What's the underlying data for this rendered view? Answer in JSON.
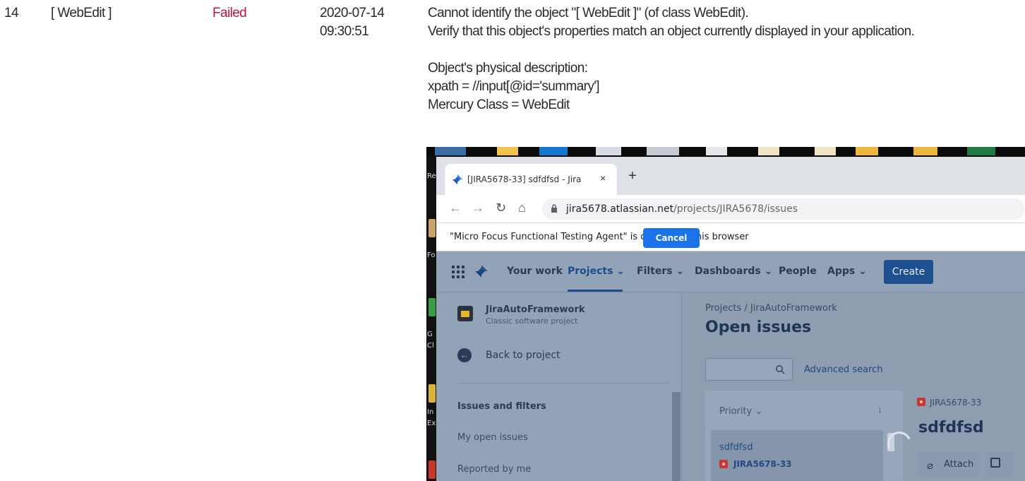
{
  "row": {
    "step_number": "14",
    "object": "[ WebEdit ]",
    "status": "Failed",
    "date": "2020-07-14",
    "time": "09:30:51",
    "details": {
      "line1": "Cannot identify the object \"[ WebEdit ]\" (of class WebEdit).",
      "line2": "Verify that this object's properties match an object currently displayed in your application.",
      "line3": "Object's physical description:",
      "line4": "xpath = //input[@id='summary']",
      "line5": "Mercury Class = WebEdit"
    },
    "status_color": "#c0143c"
  },
  "screenshot": {
    "desktop_labels": [
      "Rec",
      "Fo",
      "G",
      "Cl",
      "In",
      "Ex"
    ],
    "browser": {
      "tab_title": "[JIRA5678-33] sdfdfsd - Jira",
      "tab_close": "×",
      "new_tab": "+",
      "url_host": "jira5678.atlassian.net",
      "url_path": "/projects/JIRA5678/issues",
      "infobar_message": "\"Micro Focus Functional Testing Agent\" is debugging this browser",
      "cancel_label": "Cancel"
    },
    "jira": {
      "nav": {
        "your_work": "Your work",
        "projects": "Projects",
        "filters": "Filters",
        "dashboards": "Dashboards",
        "people": "People",
        "apps": "Apps",
        "create": "Create",
        "chevron": "⌄"
      },
      "sidebar": {
        "project_name": "JiraAutoFramework",
        "project_type": "Classic software project",
        "back": "Back to project",
        "section": "Issues and filters",
        "items": [
          "My open issues",
          "Reported by me"
        ]
      },
      "main": {
        "breadcrumb": "Projects  /  JiraAutoFramework",
        "title": "Open issues",
        "advanced_search": "Advanced search",
        "sort_label": "Priority",
        "sort_chevron": "⌄",
        "sort_arrow": "↓",
        "issue_title": "sdfdfsd",
        "issue_key": "JIRA5678-33",
        "detail_key": "JIRA5678-33",
        "detail_title": "sdfdfsd",
        "attach": "Attach"
      }
    }
  }
}
